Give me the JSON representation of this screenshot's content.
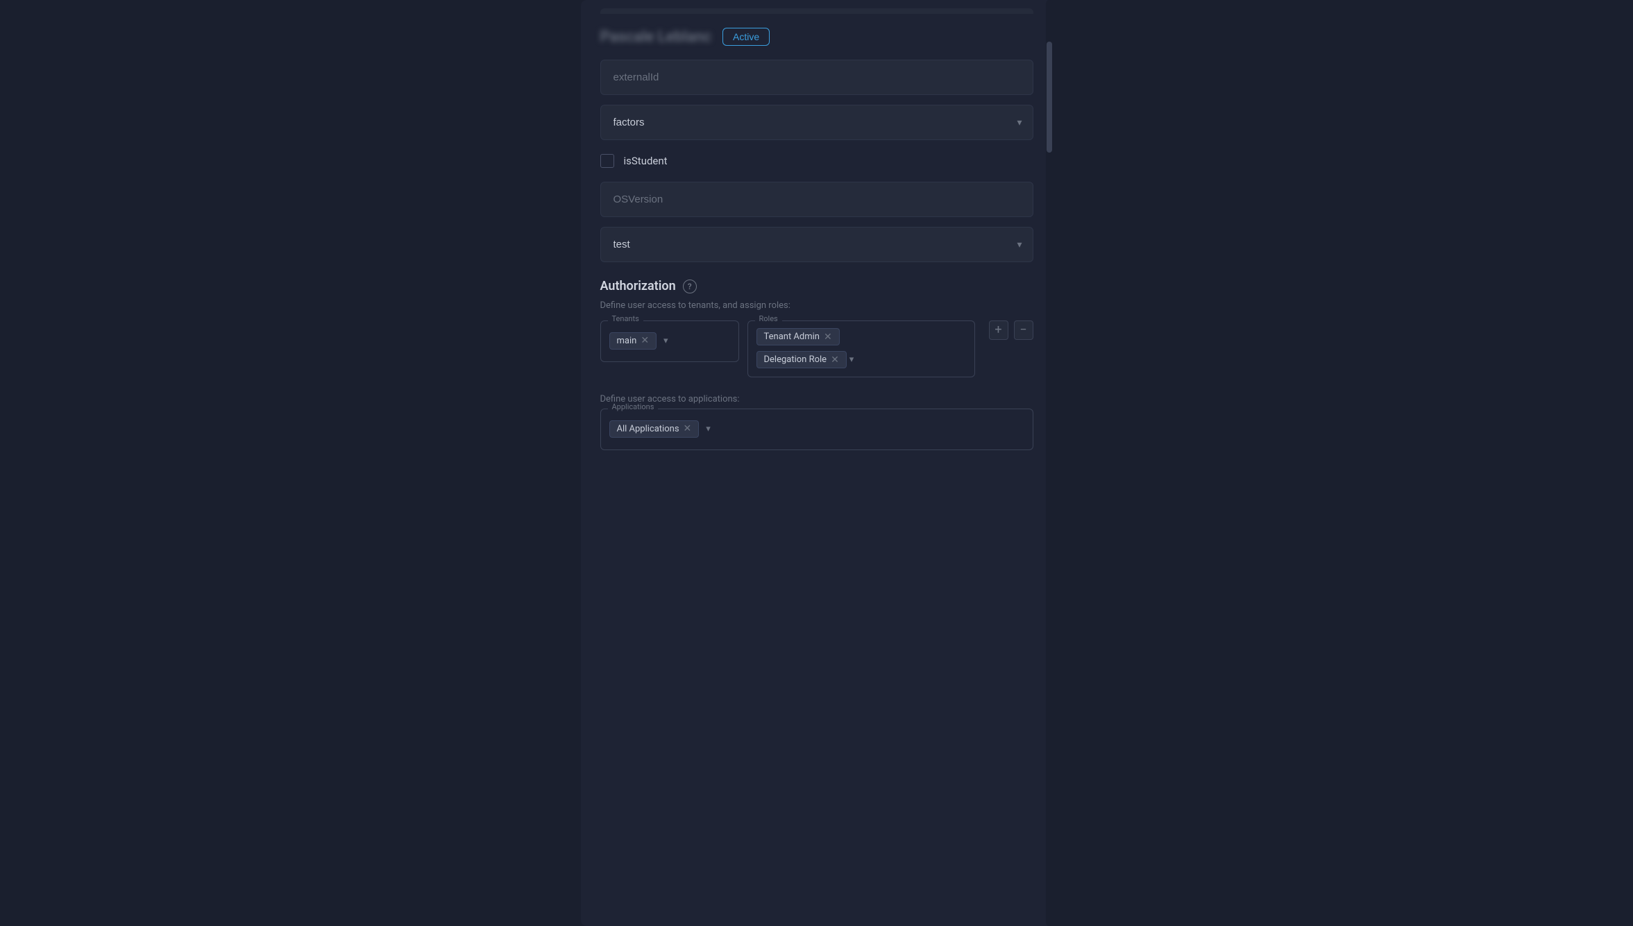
{
  "header": {
    "title": "Pascale Leblanc",
    "status_label": "Active"
  },
  "fields": {
    "external_id_placeholder": "externalId",
    "factors_label": "factors",
    "is_student_label": "isStudent",
    "os_version_placeholder": "OSVersion",
    "test_label": "test"
  },
  "authorization": {
    "title": "Authorization",
    "help_icon": "?",
    "subtitle": "Define user access to tenants, and assign roles:",
    "tenants_legend": "Tenants",
    "tenant_tag": "main",
    "roles_legend": "Roles",
    "role_tag_1": "Tenant Admin",
    "role_tag_2": "Delegation Role",
    "add_button": "+",
    "remove_button": "−",
    "apps_subtitle": "Define user access to applications:",
    "applications_legend": "Applications",
    "all_applications_tag": "All Applications"
  }
}
